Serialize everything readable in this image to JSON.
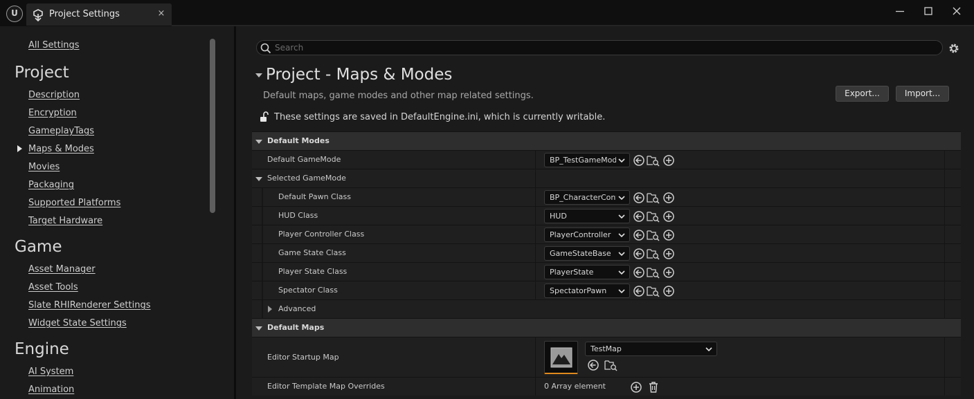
{
  "window": {
    "tab_title": "Project Settings",
    "close_glyph": "×"
  },
  "sidebar": {
    "all_settings": "All Settings",
    "sections": [
      {
        "title": "Project",
        "items": [
          "Description",
          "Encryption",
          "GameplayTags",
          "Maps & Modes",
          "Movies",
          "Packaging",
          "Supported Platforms",
          "Target Hardware"
        ]
      },
      {
        "title": "Game",
        "items": [
          "Asset Manager",
          "Asset Tools",
          "Slate RHIRenderer Settings",
          "Widget State Settings"
        ]
      },
      {
        "title": "Engine",
        "items": [
          "AI System",
          "Animation"
        ]
      }
    ],
    "selected_item": "Maps & Modes"
  },
  "search": {
    "placeholder": "Search",
    "value": ""
  },
  "header": {
    "title": "Project - Maps & Modes",
    "description": "Default maps, game modes and other map related settings.",
    "export_label": "Export...",
    "import_label": "Import...",
    "info": "These settings are saved in DefaultEngine.ini, which is currently writable."
  },
  "details": {
    "default_modes": {
      "label": "Default Modes",
      "default_gamemode": {
        "label": "Default GameMode",
        "value": "BP_TestGameMode"
      },
      "selected_gamemode": {
        "label": "Selected GameMode",
        "rows": [
          {
            "label": "Default Pawn Class",
            "value": "BP_CharacterController"
          },
          {
            "label": "HUD Class",
            "value": "HUD"
          },
          {
            "label": "Player Controller Class",
            "value": "PlayerController"
          },
          {
            "label": "Game State Class",
            "value": "GameStateBase"
          },
          {
            "label": "Player State Class",
            "value": "PlayerState"
          },
          {
            "label": "Spectator Class",
            "value": "SpectatorPawn"
          }
        ]
      },
      "advanced": "Advanced"
    },
    "default_maps": {
      "label": "Default Maps",
      "editor_startup_map": {
        "label": "Editor Startup Map",
        "value": "TestMap"
      },
      "editor_template_map_overrides": {
        "label": "Editor Template Map Overrides",
        "value": "0 Array element"
      }
    }
  },
  "icons": {
    "use_selected": "arrow-left-circle-icon",
    "browse": "folder-search-icon",
    "create_new": "plus-circle-icon",
    "delete": "trash-icon"
  },
  "colors": {
    "accent_orange": "#e08a1e",
    "background": "#151515",
    "panel": "#1b1b1b",
    "category_row": "#2e2e2e"
  }
}
